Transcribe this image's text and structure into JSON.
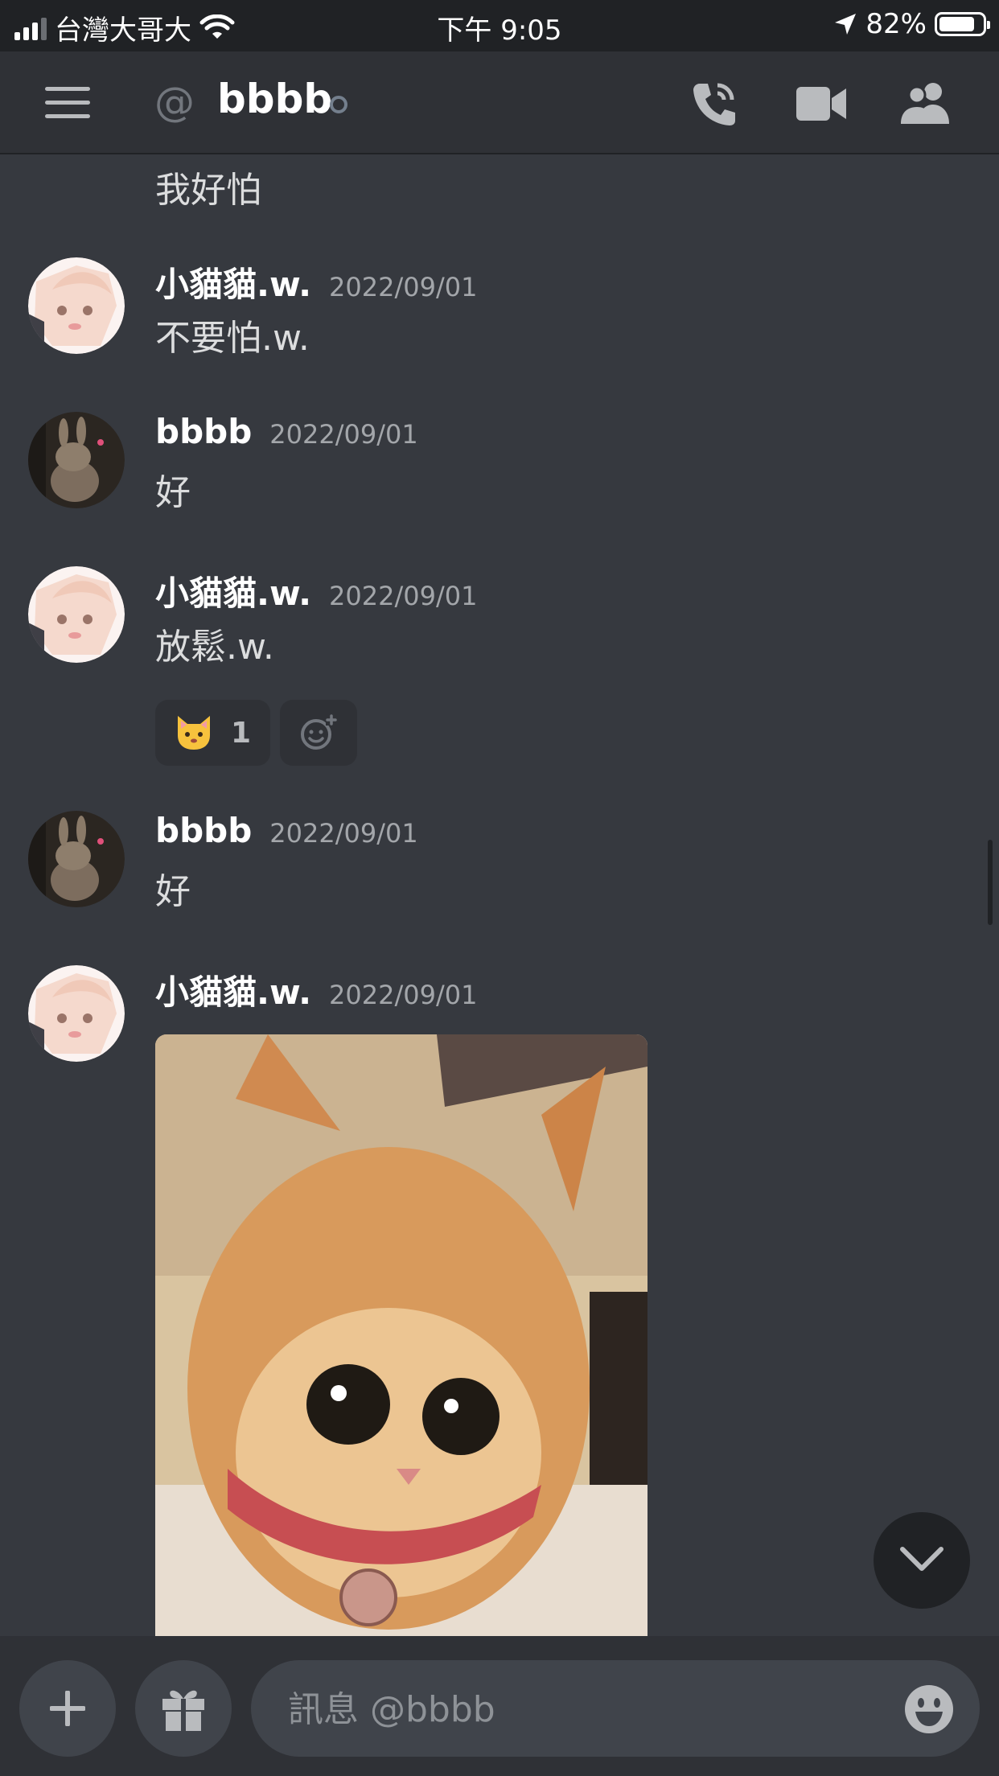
{
  "status_bar": {
    "carrier": "台灣大哥大",
    "time": "下午 9:05",
    "battery": "82%",
    "battery_level": 0.82
  },
  "header": {
    "at_symbol": "@",
    "channel_name": "bbbb",
    "icons": [
      "hamburger-icon",
      "phone-call-icon",
      "video-camera-icon",
      "members-icon"
    ]
  },
  "messages": {
    "top_continuation": "我好怕",
    "items": [
      {
        "author": "小貓貓.w.",
        "timestamp": "2022/09/01",
        "text": "不要怕.w."
      },
      {
        "author": "bbbb",
        "timestamp": "2022/09/01",
        "text": "好"
      },
      {
        "author": "小貓貓.w.",
        "timestamp": "2022/09/01",
        "text": "放鬆.w.",
        "reactions": [
          {
            "emoji": "cat-face",
            "count": "1"
          }
        ]
      },
      {
        "author": "bbbb",
        "timestamp": "2022/09/01",
        "text": "好"
      },
      {
        "author": "小貓貓.w.",
        "timestamp": "2022/09/01",
        "attachment": "cat-photo"
      }
    ]
  },
  "composer": {
    "placeholder": "訊息 @bbbb",
    "icons": [
      "plus-icon",
      "gift-icon",
      "emoji-icon"
    ]
  },
  "colors": {
    "background": "#36393f",
    "header": "#2f3136",
    "input": "#40444b",
    "text": "#dcddde",
    "muted": "#a3a6aa"
  }
}
